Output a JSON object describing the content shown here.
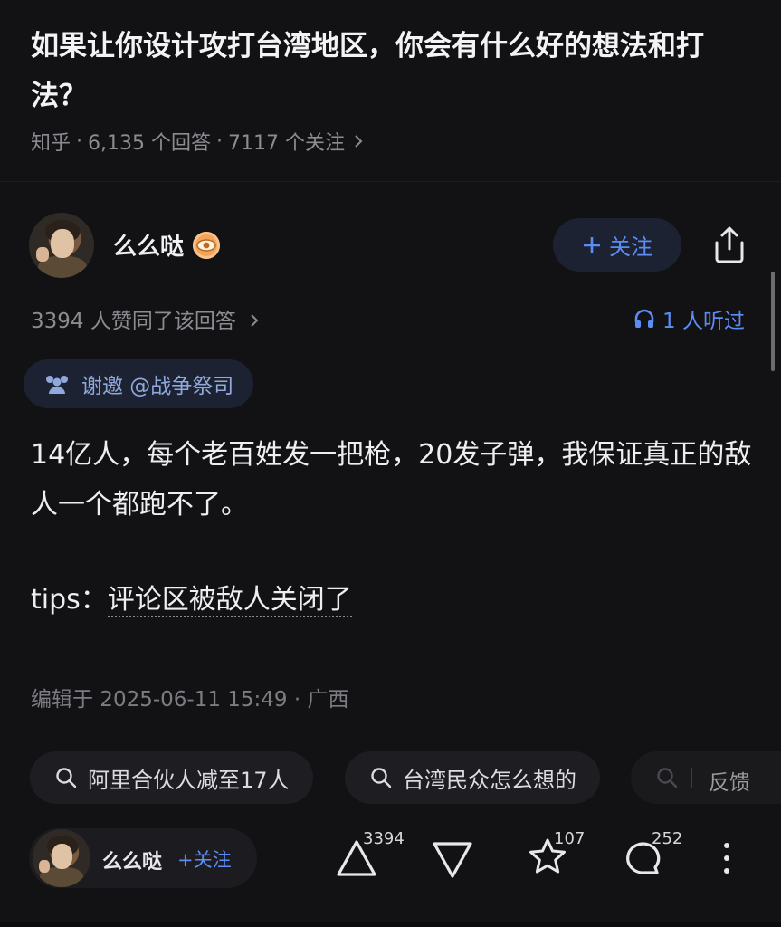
{
  "question": {
    "title": "如果让你设计攻打台湾地区，你会有什么好的想法和打法？",
    "source": "知乎",
    "answers_count": "6,135 个回答",
    "followers_count": "7117 个关注",
    "separator": "·"
  },
  "answer": {
    "author_name": "么么哒",
    "follow_label": "关注",
    "likes_text": "3394 人赞同了该回答",
    "listened_text": "1 人听过",
    "invite_text": "谢邀 @战争祭司",
    "content_line1": "14亿人，每个老百姓发一把枪，20发子弹，我保证真正的敌人一个都跑不了。",
    "tips_prefix": "tips：",
    "tips_text": "评论区被敌人关闭了",
    "edited_text": "编辑于 2025-06-11 15:49 · 广西"
  },
  "related_searches": [
    {
      "label": "阿里合伙人减至17人"
    },
    {
      "label": "台湾民众怎么想的"
    }
  ],
  "feedback_label": "反馈",
  "bottom_bar": {
    "author_name": "么么哒",
    "follow_label": "关注",
    "upvote_count": "3394",
    "favorite_count": "107",
    "comment_count": "252"
  },
  "icons": {
    "chevron": "chevron-right-icon",
    "plus": "plus-icon",
    "share": "share-icon",
    "headphones": "headphones-icon",
    "invite": "group-icon",
    "search": "search-icon",
    "upvote": "upvote-icon",
    "downvote": "downvote-icon",
    "star": "star-icon",
    "comment": "comment-icon",
    "more": "more-vertical-icon"
  },
  "colors": {
    "background": "#121214",
    "accent_blue": "#5b8df5",
    "badge_orange": "#f2a55a"
  }
}
